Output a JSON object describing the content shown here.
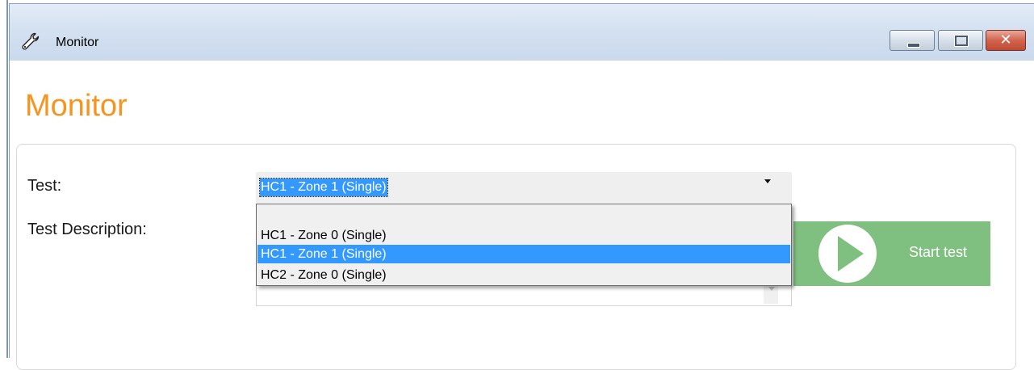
{
  "window": {
    "title": "Monitor",
    "icon": "wrench-icon",
    "controls": [
      "minimize-icon",
      "maximize-icon",
      "close-icon"
    ],
    "close_glyph": "✕"
  },
  "page": {
    "title": "Monitor",
    "accent_color": "#f7941d"
  },
  "form": {
    "test_label": "Test:",
    "test_description_label": "Test Description:",
    "test_select": {
      "selected": "HC1 - Zone 1 (Single)",
      "options": [
        "HC1 - Zone 0 (Single)",
        "HC1 - Zone 1 (Single)",
        "HC2 - Zone 0 (Single)"
      ],
      "highlighted_index": 1,
      "highlight_color": "#3399ff"
    }
  },
  "start_button": {
    "label": "Start test",
    "icon": "play-icon",
    "color": "#7fbf7f"
  }
}
